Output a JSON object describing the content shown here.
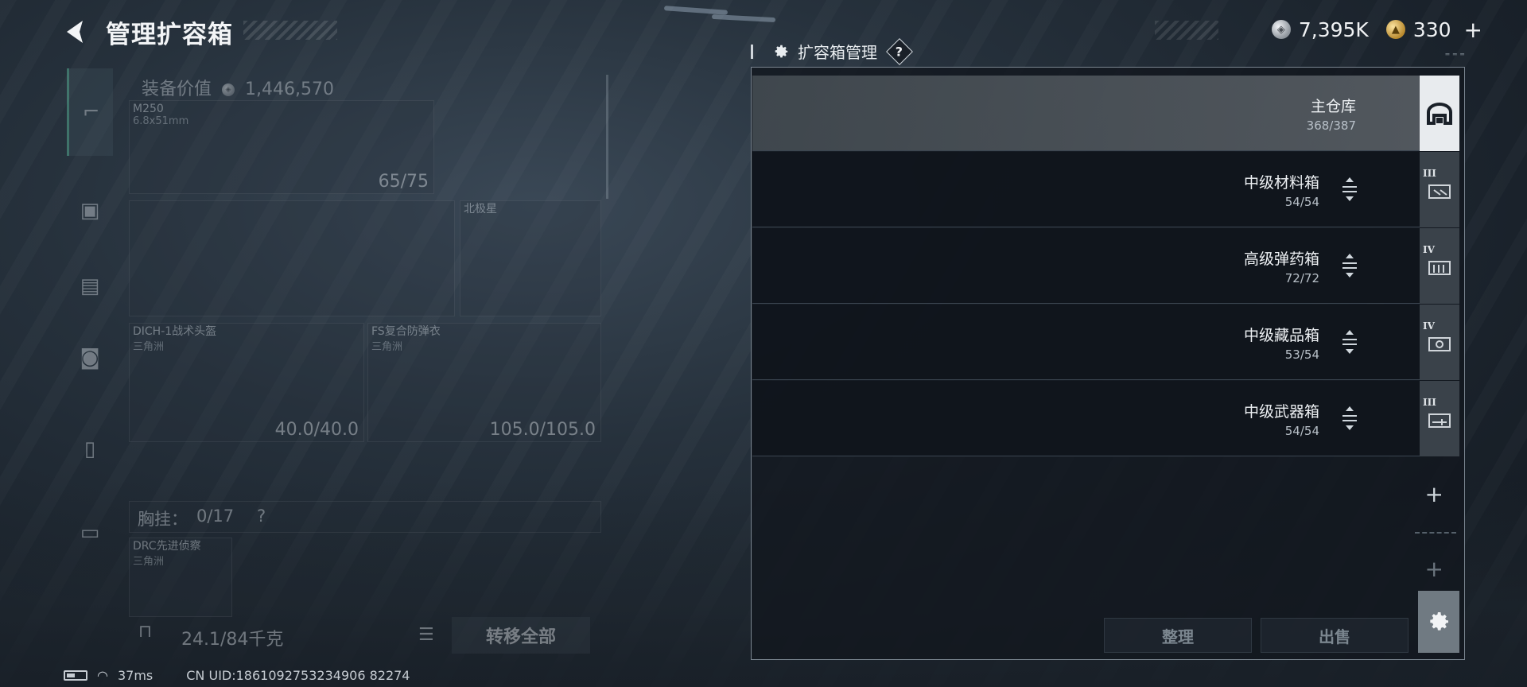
{
  "header": {
    "title": "管理扩容箱"
  },
  "currency": {
    "silver_value": "7,395K",
    "gold_value": "330",
    "add_label": "+"
  },
  "equipment": {
    "value_label": "装备价值",
    "value_amount": "1,446,570",
    "primary_weapon": {
      "name": "M250",
      "caliber": "6.8x51mm",
      "durability": "65/75"
    },
    "melee": {
      "name": "北极星"
    },
    "helmet": {
      "name": "DICH-1战术头盔",
      "origin": "三角洲",
      "durability": "40.0/40.0"
    },
    "armor": {
      "name": "FS复合防弹衣",
      "origin": "三角洲",
      "durability": "105.0/105.0"
    },
    "chest_rig": {
      "label": "胸挂：",
      "count": "0/17",
      "help": "?"
    },
    "backpack": {
      "name": "DRC先进侦察",
      "origin": "三角洲"
    },
    "weight": "24.1/84千克",
    "transfer_all": "转移全部"
  },
  "status_bar": {
    "ping": "37ms",
    "uid": "CN UID:1861092753234906 82274"
  },
  "box_manager": {
    "title": "扩容箱管理",
    "help": "?",
    "boxes": [
      {
        "name": "主仓库",
        "count": "368/387",
        "tier": "",
        "icon": "warehouse-icon"
      },
      {
        "name": "中级材料箱",
        "count": "54/54",
        "tier": "III",
        "icon": "material-crate-icon"
      },
      {
        "name": "高级弹药箱",
        "count": "72/72",
        "tier": "IV",
        "icon": "ammo-crate-icon"
      },
      {
        "name": "中级藏品箱",
        "count": "53/54",
        "tier": "IV",
        "icon": "collection-crate-icon"
      },
      {
        "name": "中级武器箱",
        "count": "54/54",
        "tier": "III",
        "icon": "weapon-crate-icon"
      }
    ],
    "add_slot": "+",
    "sort_label": "整理",
    "sell_label": "出售"
  },
  "colors": {
    "panel_bg": "#12171e",
    "selected_row": "#5c6268",
    "accent_green": "#5ec3a3",
    "settings_btn": "#707a82"
  }
}
